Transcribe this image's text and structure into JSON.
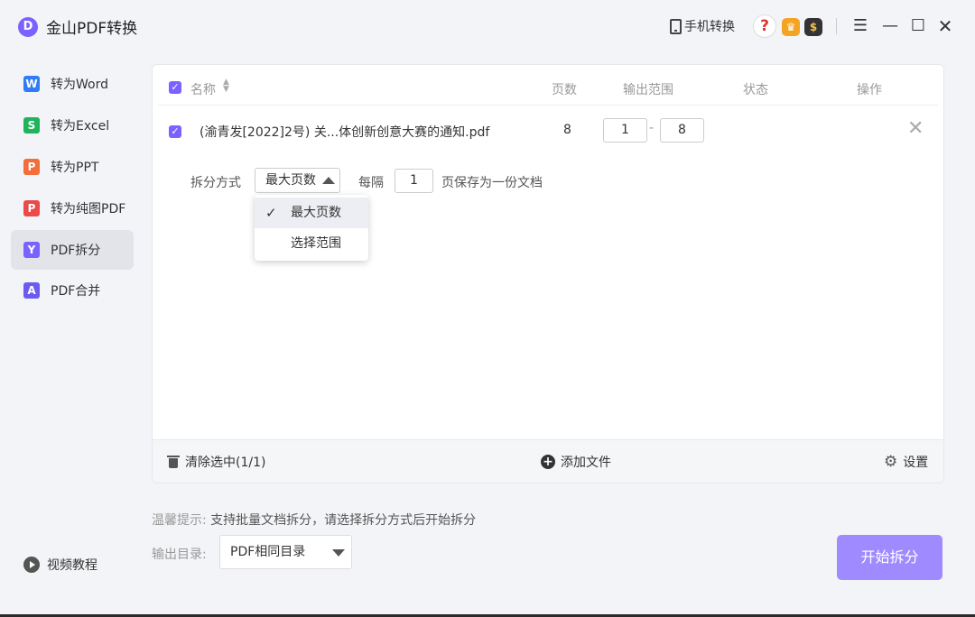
{
  "app": {
    "title": "金山PDF转换",
    "logo_letter": "D"
  },
  "titlebar": {
    "mobile_label": "手机转换",
    "help_glyph": "?",
    "menu_glyph": "☰",
    "minimize_glyph": "—",
    "maximize_glyph": "☐",
    "close_glyph": "✕"
  },
  "sidebar": {
    "items": [
      {
        "label": "转为Word",
        "glyph": "W",
        "color": "#2f7cf6"
      },
      {
        "label": "转为Excel",
        "glyph": "S",
        "color": "#1fb35c"
      },
      {
        "label": "转为PPT",
        "glyph": "P",
        "color": "#f46d3a"
      },
      {
        "label": "转为纯图PDF",
        "glyph": "P",
        "color": "#ec4a4a"
      },
      {
        "label": "PDF拆分",
        "glyph": "Y",
        "color": "#7b61ff"
      },
      {
        "label": "PDF合并",
        "glyph": "A",
        "color": "#6b5cf0"
      }
    ],
    "video_label": "视频教程"
  },
  "table": {
    "headers": {
      "name": "名称",
      "pages": "页数",
      "range": "输出范围",
      "status": "状态",
      "action": "操作"
    },
    "row": {
      "file_name": "(渝青发[2022]2号) 关...体创新创意大赛的通知.pdf",
      "pages": "8",
      "range_from": "1",
      "range_to": "8",
      "dash": "-"
    },
    "split": {
      "method_label": "拆分方式",
      "method_value": "最大页数",
      "every_label": "每隔",
      "every_value": "1",
      "save_label": "页保存为一份文档"
    },
    "dropdown": {
      "options": [
        {
          "label": "最大页数",
          "selected": true
        },
        {
          "label": "选择范围",
          "selected": false
        }
      ]
    },
    "footer": {
      "clear_label": "清除选中(1/1)",
      "add_label": "添加文件",
      "settings_label": "设置"
    }
  },
  "bottom": {
    "tip_head": "温馨提示:",
    "tip_body": "支持批量文档拆分，请选择拆分方式后开始拆分",
    "output_label": "输出目录:",
    "output_value": "PDF相同目录",
    "start_label": "开始拆分"
  },
  "colors": {
    "accent": "#7b61ff",
    "start_button": "#9f8bff"
  }
}
